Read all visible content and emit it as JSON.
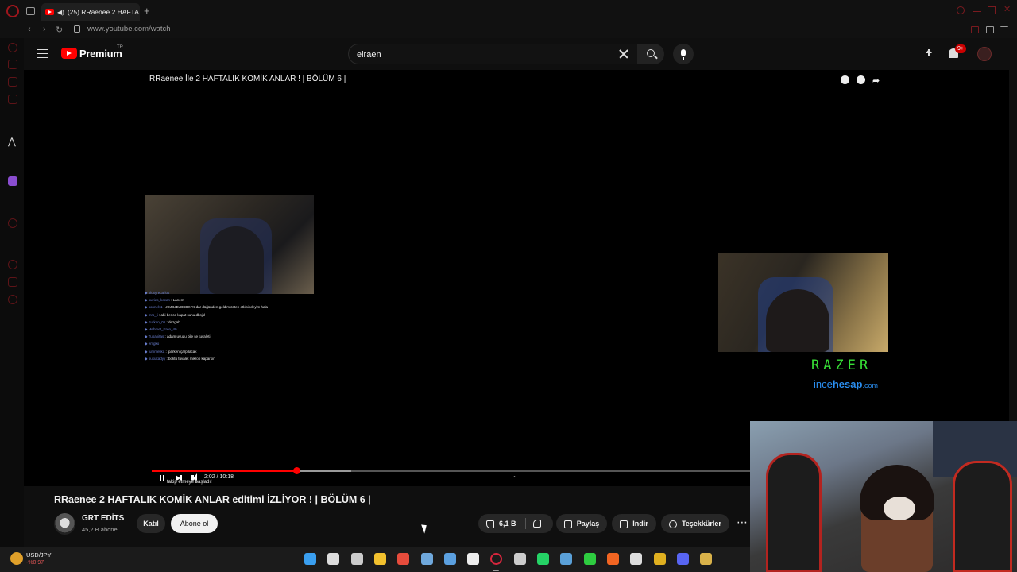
{
  "browser": {
    "tab_title": "(25) RRaenee 2 HAFTA",
    "tab_add": "+",
    "url": "www.youtube.com/watch",
    "nav_back": "‹",
    "nav_forward": "›",
    "nav_reload": "↻"
  },
  "header": {
    "logo_text": "Premium",
    "country_code": "TR",
    "search_value": "elraen",
    "notification_count": "9+"
  },
  "video": {
    "overlay_title": "RRaenee İle 2 HAFTALIK KOMİK ANLAR ! | BÖLÜM 6 |",
    "time": "2:02 / 10:18",
    "progress": 0.24,
    "buffered": 0.33,
    "subtitle": "takip etmeye başladı!",
    "sponsor_razer": "RAZER",
    "sponsor_ince": "ince",
    "sponsor_hesap": "hesap",
    "sponsor_com": ".com",
    "chat": [
      {
        "user": "bluxyrecarlos",
        "msg": ""
      },
      {
        "user": "suzies_kocan",
        "msg": ": Lanem"
      },
      {
        "user": "sonnel11",
        "msg": ": JDJDJDJDKDKFK dar düğünden geldim zaten etkisindeyim hala"
      },
      {
        "user": "mrs_li",
        "msg": ": abi bence kapat şunu dbsjsl"
      },
      {
        "user": "Furkan_06",
        "msg": ": dezgah"
      },
      {
        "user": "Mehmet_Eren_49",
        "msg": ""
      },
      {
        "user": "Tubanitas",
        "msg": ": adam uyudu bile se tuvaleti"
      },
      {
        "user": "emgko",
        "msg": ""
      },
      {
        "user": "tummelika",
        "msg": ": lparken çarpılacak"
      },
      {
        "user": "pukukadyy",
        "msg": ": boktu tuvalet mikrop kaparsın"
      }
    ]
  },
  "meta": {
    "title": "RRaenee 2 HAFTALIK KOMİK ANLAR editimi İZLİYOR ! | BÖLÜM 6 |",
    "channel_name": "GRT EDİTS",
    "subscribers": "45,2 B abone",
    "join_label": "Katıl",
    "subscribe_label": "Abone ol",
    "likes": "6,1 B",
    "share_label": "Paylaş",
    "download_label": "İndir",
    "thanks_label": "Teşekkürler",
    "more_label": "⋯"
  },
  "taskbar": {
    "stock_name": "USD/JPY",
    "stock_change": "-%0,97",
    "apps": [
      "windows-start",
      "search",
      "task-view",
      "file-explorer",
      "chrome",
      "app-2",
      "app-3",
      "obs",
      "opera-gx",
      "epic-games",
      "whatsapp",
      "steam",
      "xbox",
      "brave",
      "app-4",
      "app-5",
      "discord",
      "app-6"
    ]
  },
  "colors": {
    "accent": "#ff0000",
    "background": "#0f0f0f",
    "razer_green": "#37e036",
    "incehesap_blue": "#2a8ef0"
  }
}
